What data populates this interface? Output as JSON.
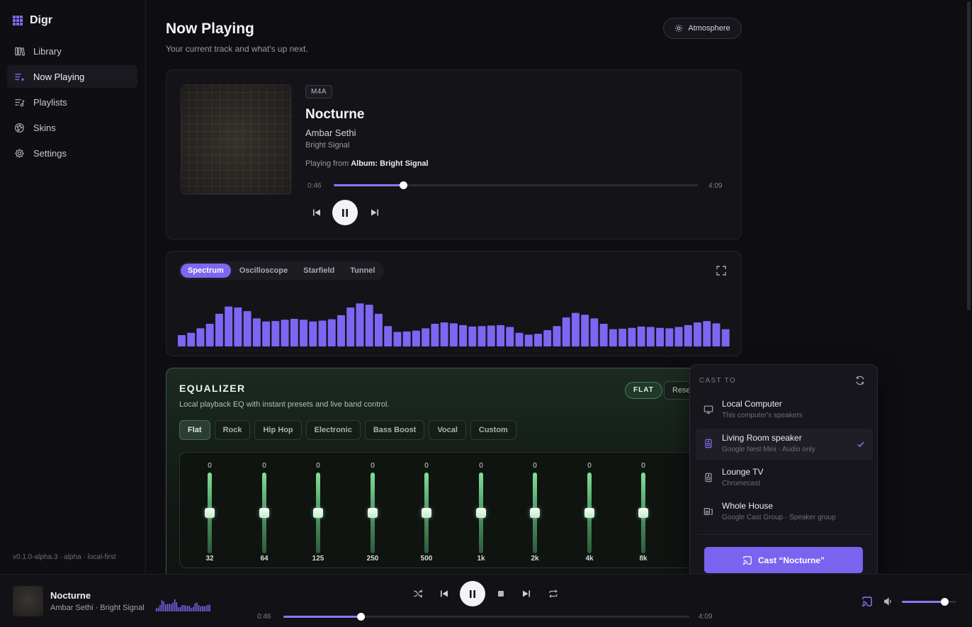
{
  "app": {
    "name": "Digr",
    "version": "v0.1.0-alpha.3 · alpha · local-first"
  },
  "sidebar": {
    "items": [
      {
        "label": "Library",
        "icon": "library-icon"
      },
      {
        "label": "Now Playing",
        "icon": "queue-icon",
        "active": true
      },
      {
        "label": "Playlists",
        "icon": "playlist-icon"
      },
      {
        "label": "Skins",
        "icon": "palette-icon"
      },
      {
        "label": "Settings",
        "icon": "gear-icon"
      }
    ]
  },
  "header": {
    "title": "Now Playing",
    "subtitle": "Your current track and what's up next.",
    "atmosphere_label": "Atmosphere"
  },
  "now_playing": {
    "format": "M4A",
    "title": "Nocturne",
    "artist": "Ambar Sethi",
    "album": "Bright Signal",
    "playing_from_prefix": "Playing from",
    "playing_from_source": "Album: Bright Signal",
    "elapsed": "0:46",
    "duration": "4:09",
    "progress": 0.19
  },
  "visualizer": {
    "tabs": [
      "Spectrum",
      "Oscilloscope",
      "Starfield",
      "Tunnel"
    ],
    "active_tab": "Spectrum",
    "accent": "#7d66f2",
    "bars": [
      0.25,
      0.3,
      0.4,
      0.5,
      0.72,
      0.88,
      0.86,
      0.78,
      0.62,
      0.55,
      0.56,
      0.59,
      0.61,
      0.59,
      0.55,
      0.57,
      0.6,
      0.69,
      0.86,
      0.95,
      0.92,
      0.72,
      0.45,
      0.32,
      0.33,
      0.35,
      0.4,
      0.5,
      0.53,
      0.51,
      0.47,
      0.44,
      0.45,
      0.46,
      0.47,
      0.43,
      0.3,
      0.26,
      0.28,
      0.36,
      0.45,
      0.64,
      0.74,
      0.7,
      0.62,
      0.5,
      0.38,
      0.39,
      0.41,
      0.44,
      0.43,
      0.41,
      0.4,
      0.43,
      0.47,
      0.53,
      0.56,
      0.51,
      0.38
    ]
  },
  "equalizer": {
    "title": "EQUALIZER",
    "subtitle": "Local playback EQ with instant presets and live band control.",
    "badge": "FLAT",
    "reset_label": "Reset",
    "presets": [
      "Flat",
      "Rock",
      "Hip Hop",
      "Electronic",
      "Bass Boost",
      "Vocal",
      "Custom"
    ],
    "active_preset": "Flat",
    "bands": [
      {
        "freq": "32",
        "gain": "0"
      },
      {
        "freq": "64",
        "gain": "0"
      },
      {
        "freq": "125",
        "gain": "0"
      },
      {
        "freq": "250",
        "gain": "0"
      },
      {
        "freq": "500",
        "gain": "0"
      },
      {
        "freq": "1k",
        "gain": "0"
      },
      {
        "freq": "2k",
        "gain": "0"
      },
      {
        "freq": "4k",
        "gain": "0"
      },
      {
        "freq": "8k",
        "gain": "0"
      }
    ]
  },
  "cast": {
    "heading": "CAST TO",
    "devices": [
      {
        "name": "Local Computer",
        "detail": "This computer's speakers",
        "icon": "monitor-icon"
      },
      {
        "name": "Living Room speaker",
        "detail": "Google Nest Mini · Audio only",
        "icon": "speaker-icon",
        "selected": true
      },
      {
        "name": "Lounge TV",
        "detail": "Chromecast",
        "icon": "speaker-icon"
      },
      {
        "name": "Whole House",
        "detail": "Google Cast Group · Speaker group",
        "icon": "speaker-group-icon"
      }
    ],
    "cast_button": "Cast “Nocturne”"
  },
  "player_bar": {
    "title": "Nocturne",
    "subtitle": "Ambar Sethi · Bright Signal",
    "elapsed": "0:46",
    "duration": "4:09",
    "progress": 0.19,
    "volume": 0.78
  }
}
